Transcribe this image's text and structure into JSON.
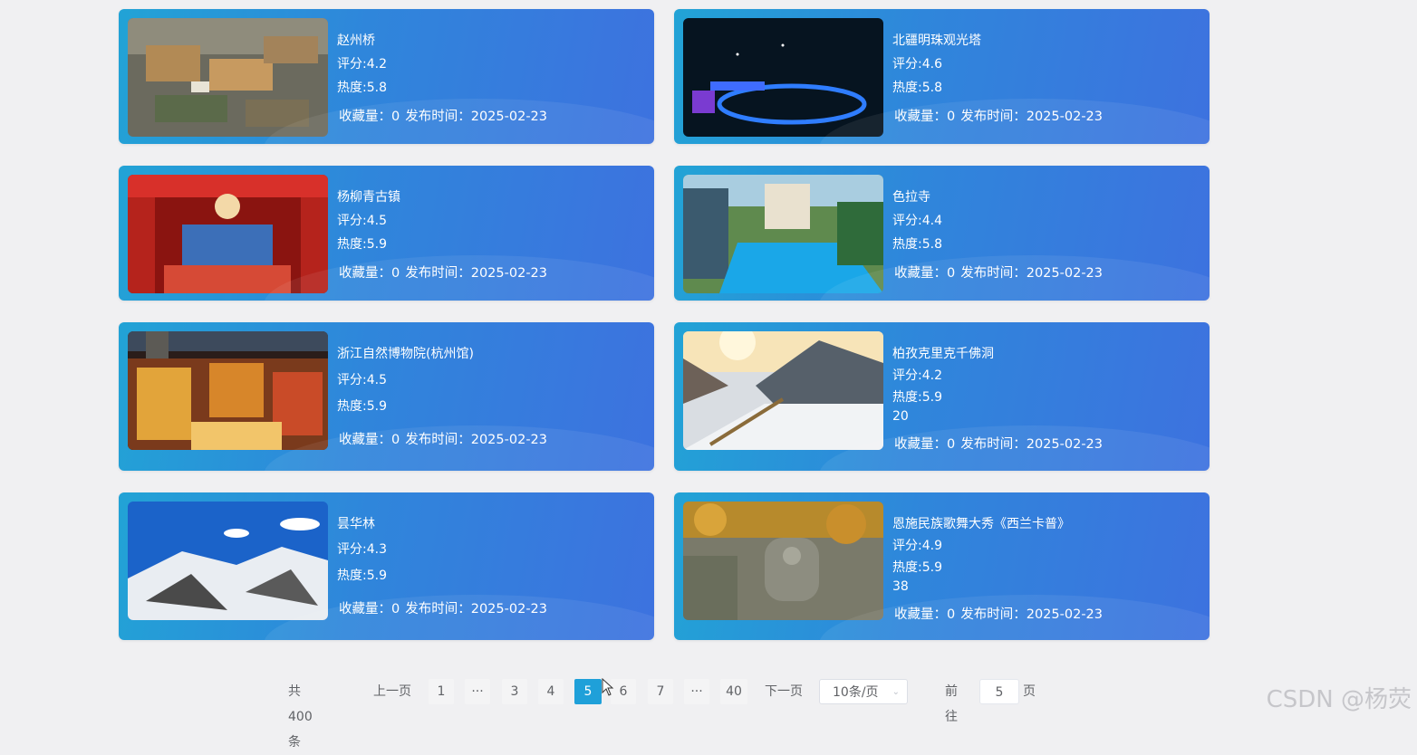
{
  "cards": [
    {
      "title": "赵州桥",
      "rating": "评分:4.2",
      "heat": "热度:5.8",
      "extra": "",
      "favorites": "收藏量：0",
      "published": "发布时间：2025-02-23",
      "image": "aerial-town"
    },
    {
      "title": "北疆明珠观光塔",
      "rating": "评分:4.6",
      "heat": "热度:5.8",
      "extra": "",
      "favorites": "收藏量：0",
      "published": "发布时间：2025-02-23",
      "image": "night-bridge"
    },
    {
      "title": "杨柳青古镇",
      "rating": "评分:4.5",
      "heat": "热度:5.9",
      "extra": "",
      "favorites": "收藏量：0",
      "published": "发布时间：2025-02-23",
      "image": "red-stage"
    },
    {
      "title": "色拉寺",
      "rating": "评分:4.4",
      "heat": "热度:5.8",
      "extra": "",
      "favorites": "收藏量：0",
      "published": "发布时间：2025-02-23",
      "image": "pool"
    },
    {
      "title": "浙江自然博物院(杭州馆)",
      "rating": "评分:4.5",
      "heat": "热度:5.9",
      "extra": "",
      "favorites": "收藏量：0",
      "published": "发布时间：2025-02-23",
      "image": "night-street"
    },
    {
      "title": "柏孜克里克千佛洞",
      "rating": "评分:4.2",
      "heat": "热度:5.9",
      "extra": "20",
      "favorites": "收藏量：0",
      "published": "发布时间：2025-02-23",
      "image": "snow-mountain-sun"
    },
    {
      "title": "昙华林",
      "rating": "评分:4.3",
      "heat": "热度:5.9",
      "extra": "",
      "favorites": "收藏量：0",
      "published": "发布时间：2025-02-23",
      "image": "snow-mountains"
    },
    {
      "title": "恩施民族歌舞大秀《西兰卡普》",
      "rating": "评分:4.9",
      "heat": "热度:5.9",
      "extra": "38",
      "favorites": "收藏量：0",
      "published": "发布时间：2025-02-23",
      "image": "buddha-relief"
    }
  ],
  "pagination": {
    "total": "共 400 条",
    "prev": "上一页",
    "next": "下一页",
    "pages": [
      "1",
      "···",
      "3",
      "4",
      "5",
      "6",
      "7",
      "···",
      "40"
    ],
    "current": "5",
    "page_size": "10条/页",
    "goto_label": "前往",
    "goto_value": "5",
    "goto_suffix": "页"
  },
  "watermark": "CSDN @杨荧",
  "colors": {
    "card_start": "#22a3d6",
    "card_end": "#3d72df",
    "active_page": "#1fa0d9"
  }
}
